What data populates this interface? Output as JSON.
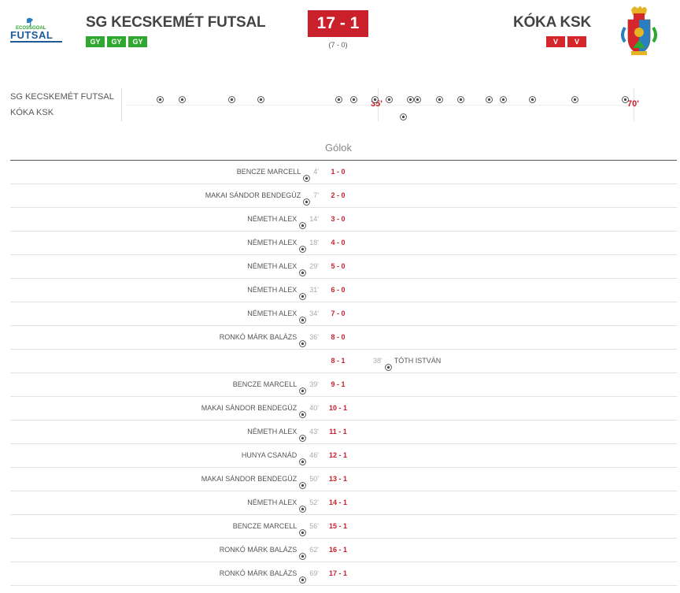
{
  "header": {
    "home": {
      "name": "SG KECSKEMÉT FUTSAL",
      "logo_text_top": "ECOSSGOAL",
      "logo_text_main": "FUTSAL",
      "form": [
        "GY",
        "GY",
        "GY"
      ]
    },
    "away": {
      "name": "KÓKA KSK",
      "form": [
        "V",
        "V"
      ]
    },
    "score": "17 - 1",
    "halftime": "(7 - 0)"
  },
  "timeline": {
    "home_label": "SG KECSKEMÉT FUTSAL",
    "away_label": "KÓKA KSK",
    "half_label": "35'",
    "full_label": "70'",
    "total_minutes": 70,
    "home_goal_minutes": [
      4,
      7,
      14,
      18,
      29,
      31,
      34,
      36,
      39,
      40,
      43,
      46,
      50,
      52,
      56,
      62,
      69
    ],
    "away_goal_minutes": [
      38
    ]
  },
  "goals": {
    "title": "Gólok",
    "rows": [
      {
        "side": "home",
        "player": "BENCZE MARCELL",
        "minute": "4'",
        "score": "1 - 0"
      },
      {
        "side": "home",
        "player": "MAKAI SÁNDOR BENDEGÚZ",
        "minute": "7'",
        "score": "2 - 0"
      },
      {
        "side": "home",
        "player": "NÉMETH ALEX",
        "minute": "14'",
        "score": "3 - 0"
      },
      {
        "side": "home",
        "player": "NÉMETH ALEX",
        "minute": "18'",
        "score": "4 - 0"
      },
      {
        "side": "home",
        "player": "NÉMETH ALEX",
        "minute": "29'",
        "score": "5 - 0"
      },
      {
        "side": "home",
        "player": "NÉMETH ALEX",
        "minute": "31'",
        "score": "6 - 0"
      },
      {
        "side": "home",
        "player": "NÉMETH ALEX",
        "minute": "34'",
        "score": "7 - 0"
      },
      {
        "side": "home",
        "player": "RONKÓ MÁRK BALÁZS",
        "minute": "36'",
        "score": "8 - 0"
      },
      {
        "side": "away",
        "player": "TÓTH ISTVÁN",
        "minute": "38'",
        "score": "8 - 1"
      },
      {
        "side": "home",
        "player": "BENCZE MARCELL",
        "minute": "39'",
        "score": "9 - 1"
      },
      {
        "side": "home",
        "player": "MAKAI SÁNDOR BENDEGÚZ",
        "minute": "40'",
        "score": "10 - 1"
      },
      {
        "side": "home",
        "player": "NÉMETH ALEX",
        "minute": "43'",
        "score": "11 - 1"
      },
      {
        "side": "home",
        "player": "HUNYA CSANÁD",
        "minute": "46'",
        "score": "12 - 1"
      },
      {
        "side": "home",
        "player": "MAKAI SÁNDOR BENDEGÚZ",
        "minute": "50'",
        "score": "13 - 1"
      },
      {
        "side": "home",
        "player": "NÉMETH ALEX",
        "minute": "52'",
        "score": "14 - 1"
      },
      {
        "side": "home",
        "player": "BENCZE MARCELL",
        "minute": "56'",
        "score": "15 - 1"
      },
      {
        "side": "home",
        "player": "RONKÓ MÁRK BALÁZS",
        "minute": "62'",
        "score": "16 - 1"
      },
      {
        "side": "home",
        "player": "RONKÓ MÁRK BALÁZS",
        "minute": "69'",
        "score": "17 - 1"
      }
    ]
  },
  "colors": {
    "accent_red": "#c9202c",
    "win_green": "#2ea82e",
    "loss_red": "#d4262b"
  }
}
